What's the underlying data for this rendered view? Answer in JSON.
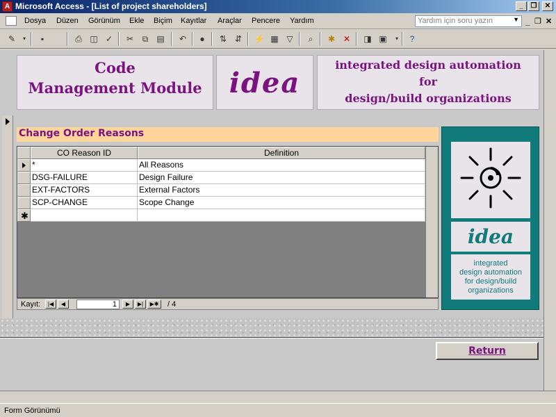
{
  "window": {
    "title": "Microsoft Access - [List of project shareholders]",
    "app_icon": "access-icon",
    "min": "_",
    "max": "❐",
    "close": "✕"
  },
  "menu": {
    "items": [
      "Dosya",
      "Düzen",
      "Görünüm",
      "Ekle",
      "Biçim",
      "Kayıtlar",
      "Araçlar",
      "Pencere",
      "Yardım"
    ],
    "help_placeholder": "Yardım için soru yazın",
    "doc_min": "_",
    "doc_restore": "❐",
    "doc_close": "✕"
  },
  "header": {
    "left_line1": "Code",
    "left_line2": "Management Module",
    "logo": "idea",
    "right_line1": "integrated design automation",
    "right_line2": "for",
    "right_line3": "design/build organizations"
  },
  "subform": {
    "title": "Change Order Reasons",
    "columns": [
      "CO Reason ID",
      "Definition"
    ],
    "rows": [
      {
        "id": "*",
        "definition": "All Reasons"
      },
      {
        "id": "DSG-FAILURE",
        "definition": "Design Failure"
      },
      {
        "id": "EXT-FACTORS",
        "definition": "External Factors"
      },
      {
        "id": "SCP-CHANGE",
        "definition": "Scope Change"
      }
    ],
    "new_row_marker": "✱"
  },
  "navigation": {
    "label": "Kayıt:",
    "current": "1",
    "total": "/ 4"
  },
  "logo_panel": {
    "logo": "idea",
    "caption_line1": "integrated",
    "caption_line2": "design automation",
    "caption_line3": "for design/build",
    "caption_line4": "organizations"
  },
  "return_button": "Return",
  "status": "Form Görünümü",
  "colors": {
    "brand_purple": "#7a1380",
    "teal": "#117b7b",
    "subform_title_bg": "#ffd59c"
  }
}
